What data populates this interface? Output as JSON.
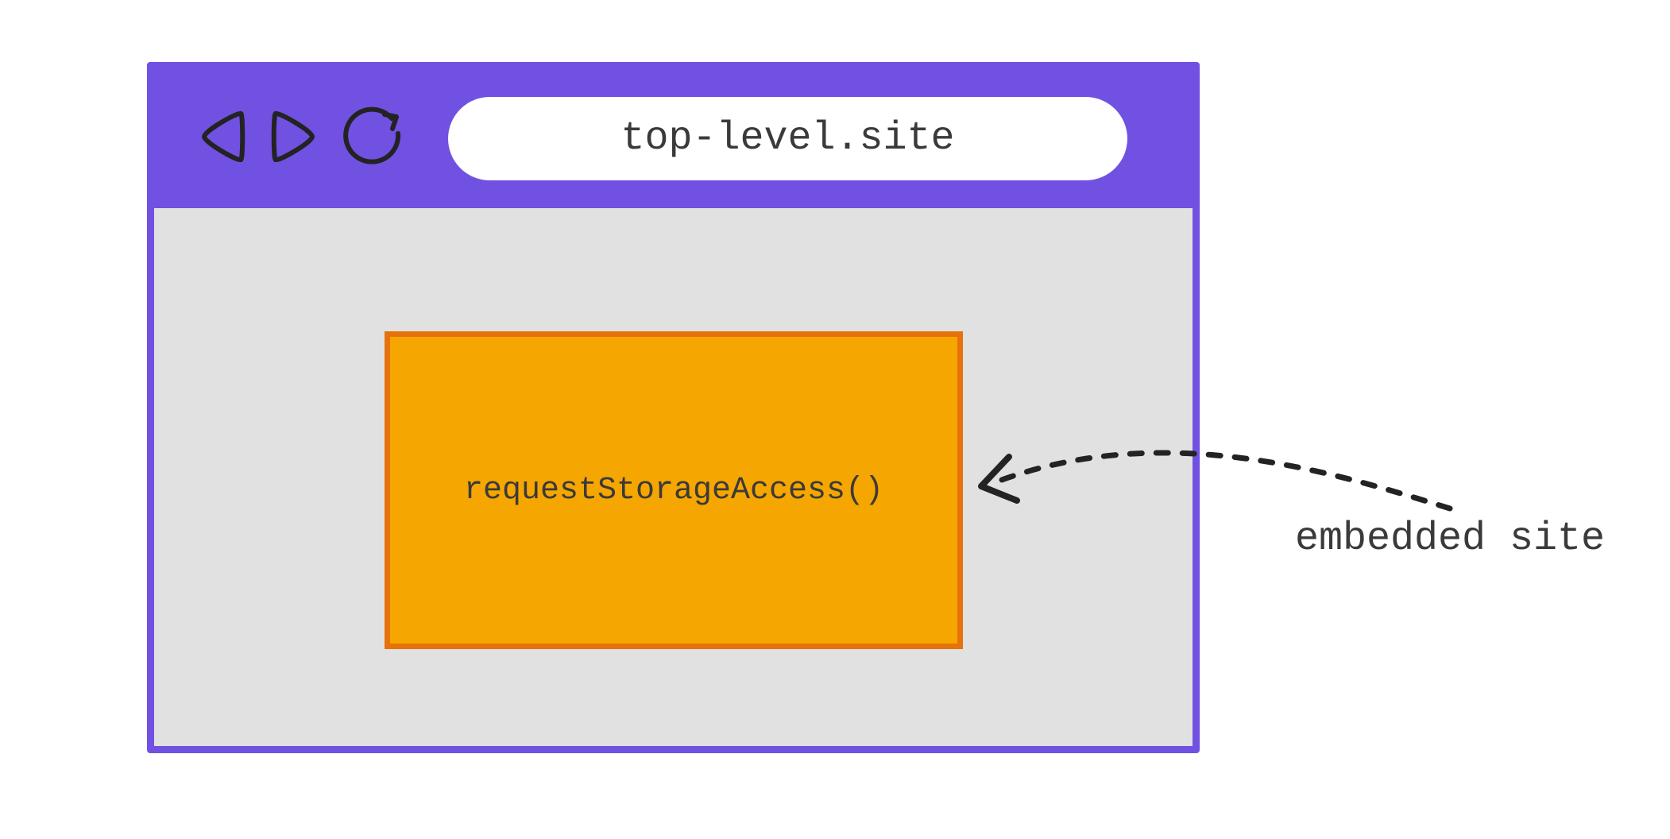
{
  "browser": {
    "url": "top-level.site",
    "nav": {
      "back": "back-icon",
      "forward": "forward-icon",
      "reload": "reload-icon"
    }
  },
  "iframe": {
    "code": "requestStorageAccess()"
  },
  "annotation": {
    "label": "embedded site"
  },
  "colors": {
    "browser_chrome": "#7151e1",
    "content_bg": "#e1e1e1",
    "iframe_fill": "#f6a600",
    "iframe_border": "#e5720a",
    "text": "#3a3a3a",
    "icon_stroke": "#232323"
  }
}
